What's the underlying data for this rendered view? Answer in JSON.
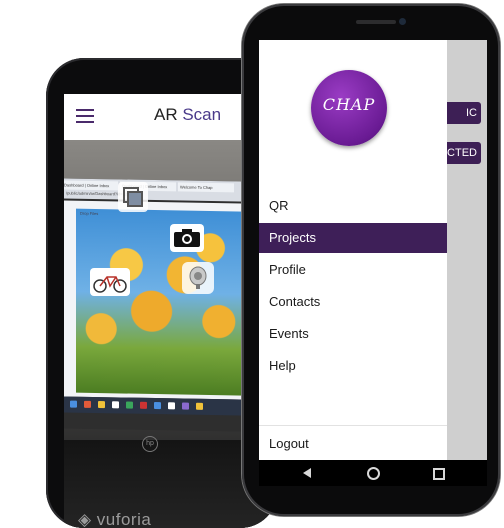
{
  "ar_phone": {
    "title_prefix": "AR ",
    "title_highlight": "Scan",
    "browser_tabs": [
      "Dashboard | Online Inbox",
      "Dashboard | Online Inbox",
      "Welcome To Chap"
    ],
    "url": "/public/admin/ar/Dashboard?id=12",
    "drop_label": "Drop Files",
    "watermark": "vuforia"
  },
  "menu_phone": {
    "logo_text": "CHAP",
    "menu_items": [
      "QR",
      "Projects",
      "Profile",
      "Contacts",
      "Events",
      "Help"
    ],
    "active_item": "Projects",
    "logout_label": "Logout",
    "behind_buttons": [
      "IC",
      "CTED"
    ],
    "colors": {
      "primary": "#3e1f58",
      "logo": "#7a2aa8"
    }
  }
}
